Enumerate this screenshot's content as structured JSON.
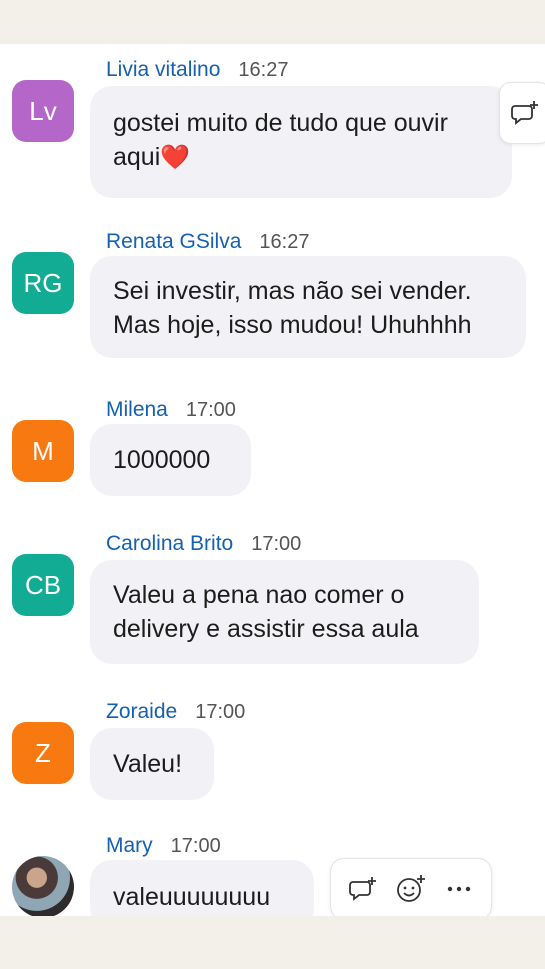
{
  "colors": {
    "name_blue": "#1560b0",
    "bubble_bg": "#f2f2f6",
    "avatar_purple": "#b467c8",
    "avatar_teal": "#12ab94",
    "avatar_orange": "#f7790f"
  },
  "messages": [
    {
      "avatar_text": "Lv",
      "avatar_color": "#b467c8",
      "name": "Livia vitalino",
      "time": "16:27",
      "lines": [
        "gostei muito de tudo que ouvir",
        "aqui"
      ],
      "emoji": "❤️"
    },
    {
      "avatar_text": "RG",
      "avatar_color": "#12ab94",
      "name": "Renata GSilva",
      "time": "16:27",
      "lines": [
        "Sei investir, mas não sei vender.",
        "Mas hoje, isso mudou! Uhuhhhh"
      ]
    },
    {
      "avatar_text": "M",
      "avatar_color": "#f7790f",
      "name": "Milena",
      "time": "17:00",
      "lines": [
        "1000000"
      ]
    },
    {
      "avatar_text": "CB",
      "avatar_color": "#12ab94",
      "name": "Carolina Brito",
      "time": "17:00",
      "lines": [
        "Valeu a pena nao comer o",
        "delivery e assistir essa aula"
      ]
    },
    {
      "avatar_text": "Z",
      "avatar_color": "#f7790f",
      "name": "Zoraide",
      "time": "17:00",
      "lines": [
        "Valeu!"
      ]
    },
    {
      "avatar_text": "",
      "avatar_color": "",
      "name": "Mary",
      "time": "17:00",
      "lines": [
        "valeuuuuuuuu"
      ]
    }
  ],
  "icons": {
    "reply_thread": "comment-add-icon",
    "add_reaction": "emoji-add-icon",
    "more": "more-horizontal-icon"
  }
}
